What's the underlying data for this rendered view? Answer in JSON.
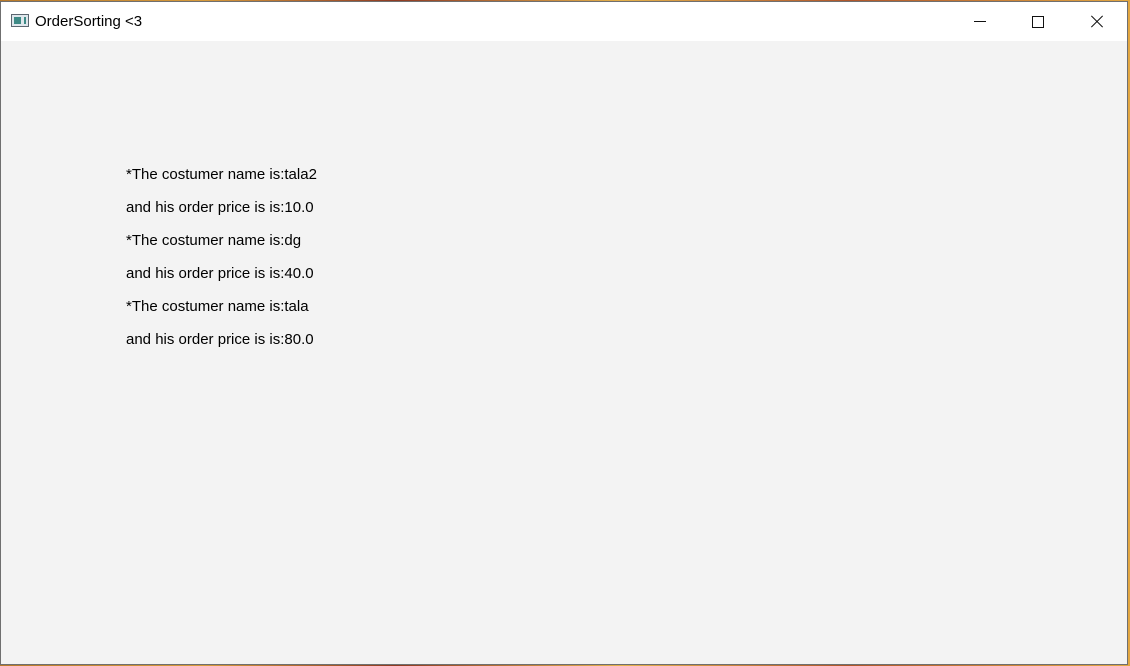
{
  "window": {
    "title": "OrderSorting <3",
    "icon": "app-window-icon",
    "controls": {
      "minimize": "minimize-icon",
      "maximize": "maximize-icon",
      "close": "close-icon"
    }
  },
  "orders": [
    {
      "name_line": "*The costumer name is:tala2",
      "price_line": "and his order price is is:10.0"
    },
    {
      "name_line": "*The costumer name is:dg",
      "price_line": "and his order price is is:40.0"
    },
    {
      "name_line": "*The costumer name is:tala",
      "price_line": "and his order price is is:80.0"
    }
  ],
  "colors": {
    "window_background": "#f3f3f3",
    "titlebar_background": "#ffffff",
    "text": "#000000"
  }
}
